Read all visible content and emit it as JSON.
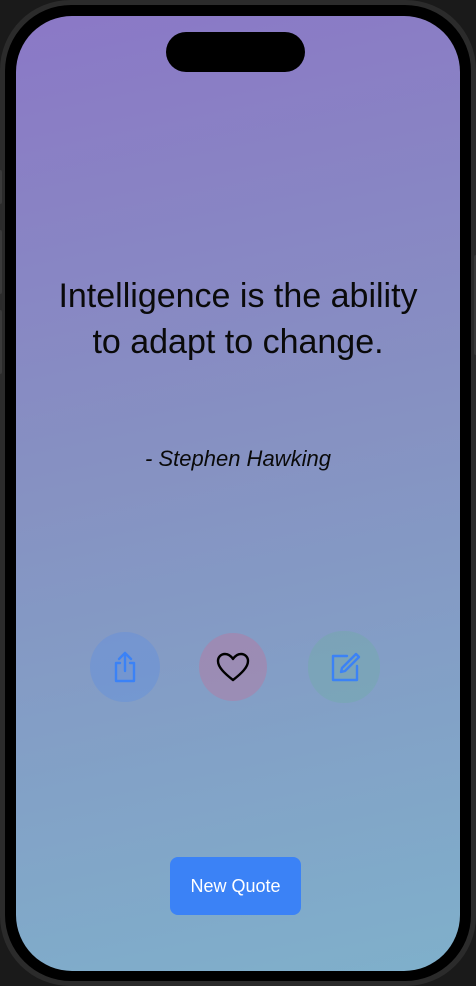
{
  "quote": {
    "text": "Intelligence is the ability to adapt to change.",
    "author": "- Stephen Hawking"
  },
  "actions": [
    {
      "name": "share",
      "icon": "share-icon",
      "color": "#3b82f6"
    },
    {
      "name": "favorite",
      "icon": "heart-icon",
      "color": "#000000"
    },
    {
      "name": "edit",
      "icon": "edit-icon",
      "color": "#3b82f6"
    }
  ],
  "new_quote_button": {
    "label": "New Quote",
    "color": "#3b82f6"
  },
  "background": {
    "gradient_top": "#8b78c6",
    "gradient_bottom": "#7fb0cb"
  }
}
